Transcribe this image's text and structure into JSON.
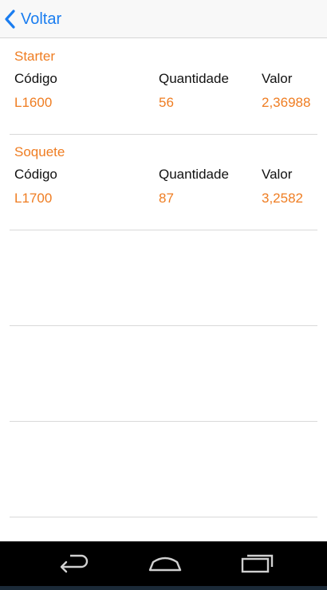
{
  "navbar": {
    "back_label": "Voltar"
  },
  "colors": {
    "accent_blue": "#1a7df0",
    "accent_orange": "#ef7d22",
    "text_dark": "#111111",
    "divider": "#d9d9d9"
  },
  "columns": {
    "code": "Código",
    "quantity": "Quantidade",
    "value": "Valor"
  },
  "items": [
    {
      "name": "Starter",
      "code": "L1600",
      "quantity": "56",
      "value": "2,36988"
    },
    {
      "name": "Soquete",
      "code": "L1700",
      "quantity": "87",
      "value": "3,2582"
    }
  ],
  "system_nav": {
    "back_icon": "android-back-icon",
    "home_icon": "android-home-icon",
    "recents_icon": "android-recents-icon"
  }
}
